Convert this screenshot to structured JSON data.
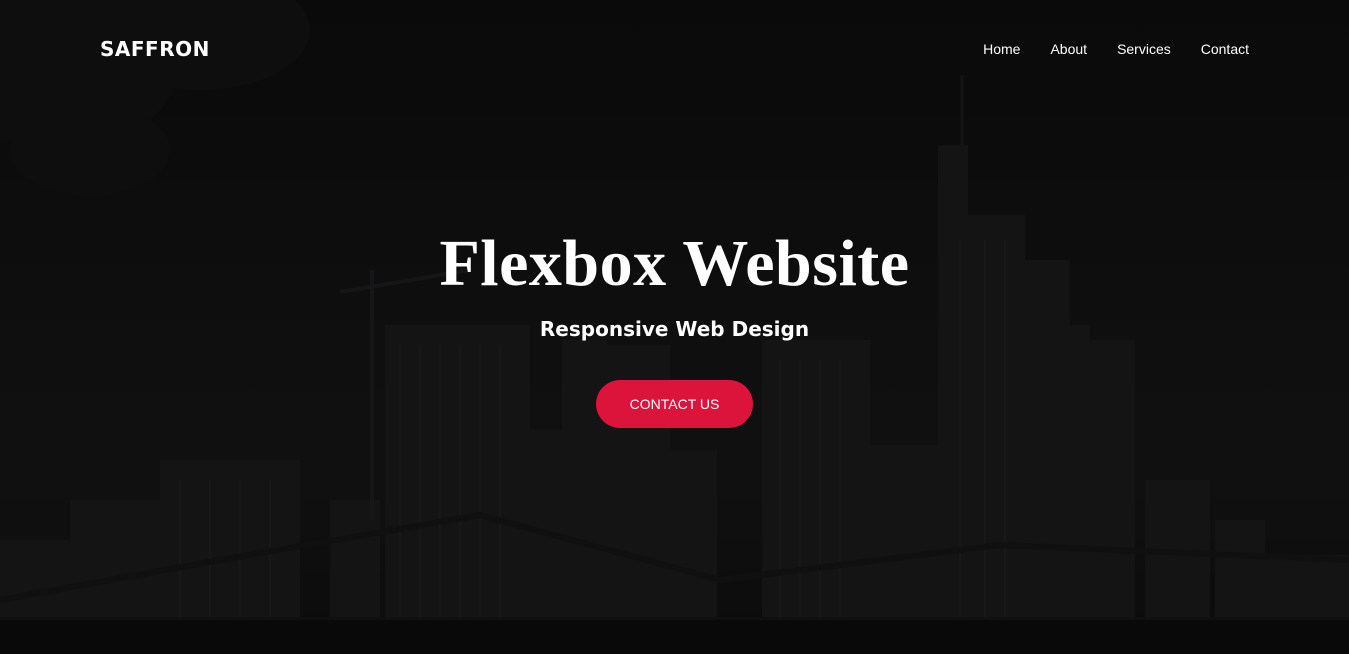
{
  "navbar": {
    "logo": "SAFFRON",
    "links": [
      "Home",
      "About",
      "Services",
      "Contact"
    ]
  },
  "hero": {
    "title": "Flexbox Website",
    "subtitle": "Responsive Web Design",
    "cta_label": "CONTACT US"
  },
  "colors": {
    "accent": "#dc143c",
    "text": "#ffffff",
    "background": "#121213"
  }
}
